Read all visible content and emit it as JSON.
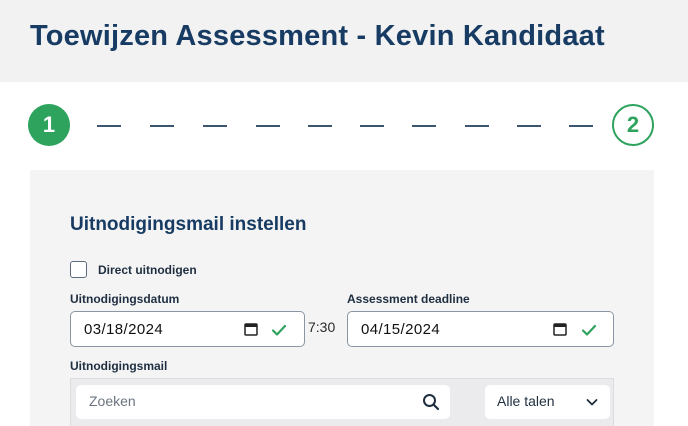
{
  "header": {
    "title": "Toewijzen Assessment - Kevin Kandidaat"
  },
  "stepper": {
    "steps": [
      {
        "number": "1",
        "state": "active"
      },
      {
        "number": "2",
        "state": "pending"
      }
    ],
    "accent_color": "#2ea35d"
  },
  "form": {
    "section_title": "Uitnodigingsmail instellen",
    "direct_invite": {
      "label": "Direct uitnodigen",
      "checked": false
    },
    "invite_date": {
      "label": "Uitnodigingsdatum",
      "value": "03/18/2024",
      "valid": true
    },
    "time": "7:30",
    "deadline": {
      "label": "Assessment deadline",
      "value": "04/15/2024",
      "valid": true
    },
    "invite_mail": {
      "label": "Uitnodigingsmail",
      "search_placeholder": "Zoeken",
      "language_select": {
        "value": "Alle talen"
      }
    }
  },
  "icons": {
    "calendar": "calendar-icon",
    "valid": "check-icon",
    "search": "search-icon",
    "dropdown": "chevron-down-icon"
  }
}
